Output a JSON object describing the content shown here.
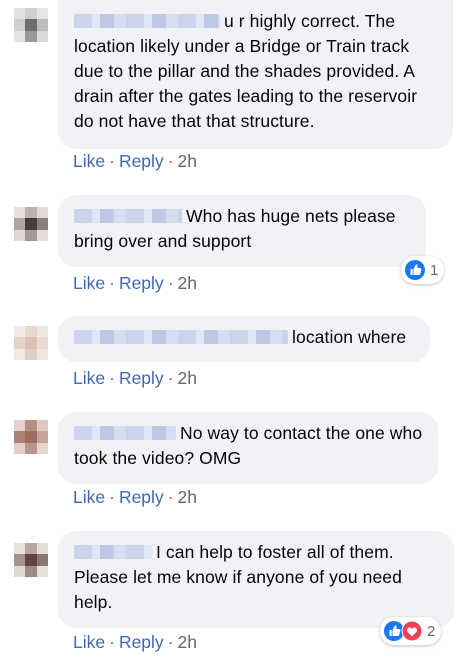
{
  "comments": [
    {
      "text": "u r highly correct. The location likely under a Bridge or Train track due to the pillar and the shades provided. A drain after the gates leading to the reservoir do not have that that structure.",
      "like": "Like",
      "reply": "Reply",
      "time": "2h"
    },
    {
      "text": "Who has huge nets please bring over and support",
      "like": "Like",
      "reply": "Reply",
      "time": "2h",
      "reaction_count": "1"
    },
    {
      "text": "location where",
      "like": "Like",
      "reply": "Reply",
      "time": "2h"
    },
    {
      "text": "No way to contact the one who took the video? OMG",
      "like": "Like",
      "reply": "Reply",
      "time": "2h"
    },
    {
      "text": "I can help to foster all of them. Please let me know if anyone of you need help.",
      "like": "Like",
      "reply": "Reply",
      "time": "2h",
      "reaction_count": "2"
    }
  ],
  "separator": "·",
  "colors": {
    "bubble": "#f0f2f5",
    "link": "#4267b2",
    "like_reaction": "#1877f2",
    "love_reaction": "#f33e58"
  }
}
